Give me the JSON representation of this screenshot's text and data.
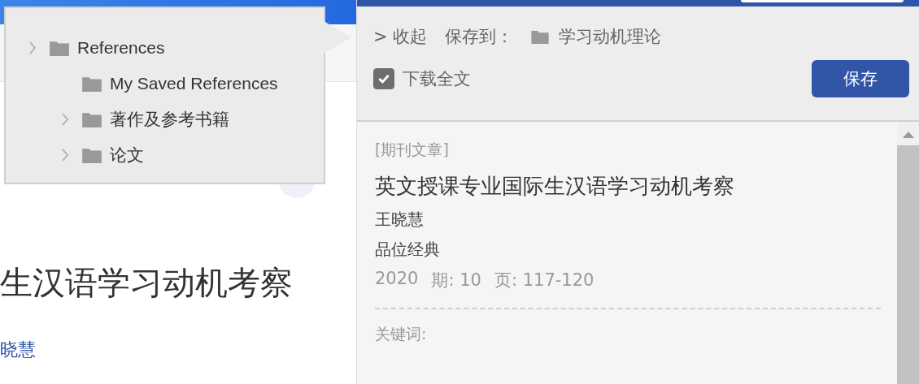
{
  "page": {
    "title": "生汉语学习动机考察",
    "author": "晓慧"
  },
  "folder_menu": {
    "items": [
      {
        "label": "References",
        "expandable": true,
        "children": [
          {
            "label": "My Saved References",
            "expandable": false
          },
          {
            "label": "著作及参考书籍",
            "expandable": true
          },
          {
            "label": "论文",
            "expandable": true
          }
        ]
      }
    ]
  },
  "panel": {
    "collapse": "> 收起",
    "save_to_label": "保存到：",
    "save_to_folder": "学习动机理论",
    "download": {
      "label": "下载全文",
      "checked": true
    },
    "save_button": "保存",
    "record": {
      "type": "[期刊文章]",
      "title": "英文授课专业国际生汉语学习动机考察",
      "author": "王晓慧",
      "journal": "品位经典",
      "meta": [
        "2020",
        "期: 10",
        "页: 117-120"
      ],
      "keywords_label": "关键词:"
    }
  }
}
